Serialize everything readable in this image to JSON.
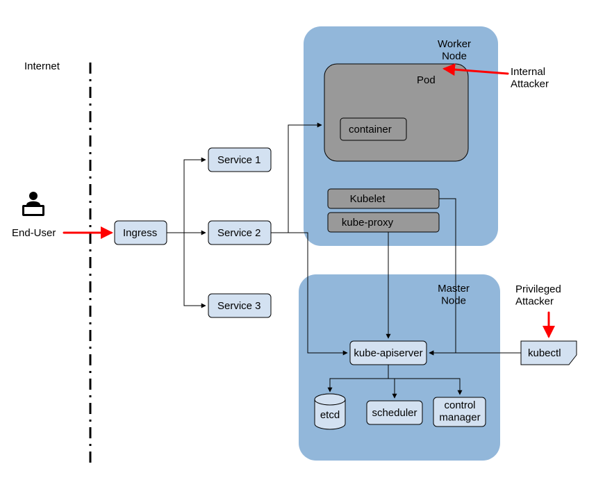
{
  "diagram": {
    "internet_label": "Internet",
    "end_user_label": "End-User",
    "ingress": "Ingress",
    "service1": "Service 1",
    "service2": "Service 2",
    "service3": "Service 3",
    "worker_node_title": "Worker\nNode",
    "pod_title": "Pod",
    "container_label": "container",
    "kubelet": "Kubelet",
    "kubeproxy": "kube-proxy",
    "master_node_title": "Master\nNode",
    "kube_apiserver": "kube-apiserver",
    "etcd": "etcd",
    "scheduler": "scheduler",
    "control_manager": "control\nmanager",
    "kubectl": "kubectl",
    "internal_attacker": "Internal\nAttacker",
    "privileged_attacker": "Privileged\nAttacker"
  },
  "colors": {
    "node_bg": "#92B7DA",
    "lightbox": "#D3E1F1",
    "graybox": "#999999",
    "graybox_light": "#AEAEAE",
    "attack_red": "#FF0000"
  },
  "chart_data": {
    "type": "table",
    "title": "Kubernetes architecture with attacker entry points",
    "entities": [
      {
        "id": "end-user",
        "label": "End-User",
        "type": "actor"
      },
      {
        "id": "ingress",
        "label": "Ingress",
        "type": "component"
      },
      {
        "id": "service1",
        "label": "Service 1",
        "type": "component"
      },
      {
        "id": "service2",
        "label": "Service 2",
        "type": "component"
      },
      {
        "id": "service3",
        "label": "Service 3",
        "type": "component"
      },
      {
        "id": "worker-node",
        "label": "Worker Node",
        "type": "node"
      },
      {
        "id": "pod",
        "label": "Pod",
        "type": "container-group",
        "parent": "worker-node"
      },
      {
        "id": "container",
        "label": "container",
        "type": "container",
        "parent": "pod"
      },
      {
        "id": "kubelet",
        "label": "Kubelet",
        "type": "component",
        "parent": "worker-node"
      },
      {
        "id": "kube-proxy",
        "label": "kube-proxy",
        "type": "component",
        "parent": "worker-node"
      },
      {
        "id": "master-node",
        "label": "Master Node",
        "type": "node"
      },
      {
        "id": "kube-apiserver",
        "label": "kube-apiserver",
        "type": "component",
        "parent": "master-node"
      },
      {
        "id": "etcd",
        "label": "etcd",
        "type": "datastore",
        "parent": "master-node"
      },
      {
        "id": "scheduler",
        "label": "scheduler",
        "type": "component",
        "parent": "master-node"
      },
      {
        "id": "control-manager",
        "label": "control manager",
        "type": "component",
        "parent": "master-node"
      },
      {
        "id": "kubectl",
        "label": "kubectl",
        "type": "component"
      },
      {
        "id": "internal-attacker",
        "label": "Internal Attacker",
        "type": "threat"
      },
      {
        "id": "privileged-attacker",
        "label": "Privileged Attacker",
        "type": "threat"
      }
    ],
    "edges": [
      {
        "from": "end-user",
        "to": "ingress",
        "kind": "attack"
      },
      {
        "from": "ingress",
        "to": "service1",
        "kind": "flow"
      },
      {
        "from": "ingress",
        "to": "service2",
        "kind": "flow"
      },
      {
        "from": "ingress",
        "to": "service3",
        "kind": "flow"
      },
      {
        "from": "service2",
        "to": "pod",
        "kind": "flow"
      },
      {
        "from": "service2",
        "to": "kube-apiserver",
        "kind": "flow"
      },
      {
        "from": "kubelet",
        "to": "kube-apiserver",
        "kind": "flow"
      },
      {
        "from": "kube-proxy",
        "to": "kube-apiserver",
        "kind": "flow"
      },
      {
        "from": "kube-apiserver",
        "to": "etcd",
        "kind": "flow"
      },
      {
        "from": "kube-apiserver",
        "to": "scheduler",
        "kind": "flow"
      },
      {
        "from": "kube-apiserver",
        "to": "control-manager",
        "kind": "flow"
      },
      {
        "from": "kubectl",
        "to": "kube-apiserver",
        "kind": "flow"
      },
      {
        "from": "internal-attacker",
        "to": "pod",
        "kind": "attack"
      },
      {
        "from": "privileged-attacker",
        "to": "kubectl",
        "kind": "attack"
      }
    ],
    "boundaries": [
      {
        "id": "internet-boundary",
        "label": "Internet",
        "left_of": "ingress"
      }
    ]
  }
}
